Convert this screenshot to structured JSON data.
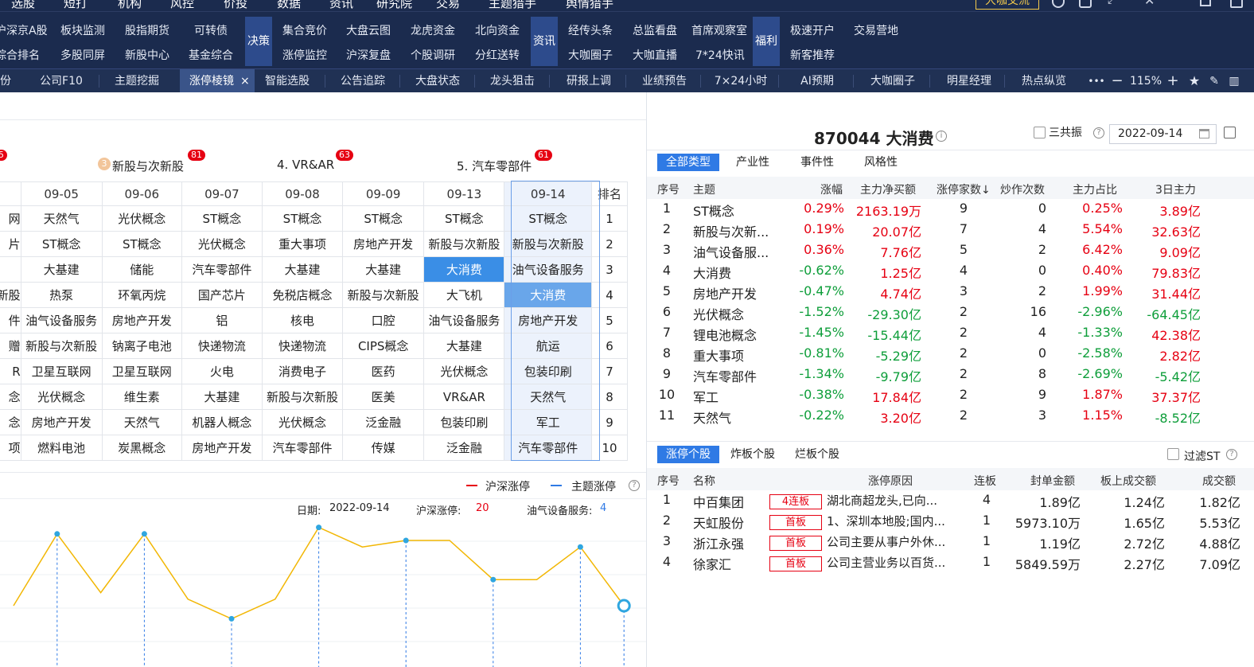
{
  "menubar": {
    "items": [
      "选股",
      "短打",
      "机构",
      "风控",
      "价投",
      "数据",
      "资讯",
      "研究院",
      "交易",
      "主题猎手",
      "舆情猎手"
    ],
    "special": "大咖交流"
  },
  "quickbar": {
    "col1": [
      "沪深京A股",
      "综合排名"
    ],
    "col2": [
      "板块监测",
      "多股同屏"
    ],
    "col3": [
      "股指期货",
      "新股中心"
    ],
    "col4": [
      "可转债",
      "基金综合"
    ],
    "grp1": "决策",
    "col5": [
      "集合竞价",
      "涨停监控"
    ],
    "col6": [
      "大盘云图",
      "沪深复盘"
    ],
    "col7": [
      "龙虎资金",
      "个股调研"
    ],
    "col8": [
      "北向资金",
      "分红送转"
    ],
    "grp2": "资讯",
    "col9": [
      "经传头条",
      "大咖圈子"
    ],
    "col10": [
      "总监看盘",
      "大咖直播"
    ],
    "col11": [
      "首席观察室",
      "7*24快讯"
    ],
    "grp3": "福利",
    "col12": [
      "极速开户",
      "新客推荐"
    ],
    "col13": [
      "交易营地"
    ]
  },
  "tabbar": {
    "tabs": [
      "份",
      "公司F10",
      "主题挖掘",
      "涨停棱镜",
      "智能选股",
      "公告追踪",
      "大盘状态",
      "龙头狙击",
      "研报上调",
      "业绩预告",
      "7×24小时",
      "AI预期",
      "大咖圈子",
      "明星经理",
      "热点纵览"
    ],
    "active_close": "×",
    "more": "•••",
    "minus": "−",
    "zoom": "115%",
    "plus": "+"
  },
  "left": {
    "featured": [
      {
        "rank": "3",
        "name": "新股与次新股",
        "count": "81"
      },
      {
        "name": "4. VR&AR",
        "count": "63"
      },
      {
        "name": "5. 汽车零部件",
        "count": "61"
      }
    ],
    "first_badge": "5",
    "dates": [
      "09-05",
      "09-06",
      "09-07",
      "09-08",
      "09-09",
      "09-13",
      "09-14"
    ],
    "rank_header": "排名",
    "cut_col": [
      "网",
      "片",
      "",
      "新股",
      "件",
      "赠",
      "R",
      "念",
      "念",
      "项"
    ],
    "grid": [
      [
        "天然气",
        "光伏概念",
        "ST概念",
        "ST概念",
        "ST概念",
        "ST概念",
        "ST概念"
      ],
      [
        "ST概念",
        "ST概念",
        "光伏概念",
        "重大事项",
        "房地产开发",
        "新股与次新股",
        "新股与次新股"
      ],
      [
        "大基建",
        "储能",
        "汽车零部件",
        "大基建",
        "大基建",
        "大消费",
        "油气设备服务"
      ],
      [
        "热泵",
        "环氧丙烷",
        "国产芯片",
        "免税店概念",
        "新股与次新股",
        "大飞机",
        "大消费"
      ],
      [
        "油气设备服务",
        "房地产开发",
        "铝",
        "核电",
        "口腔",
        "油气设备服务",
        "房地产开发"
      ],
      [
        "新股与次新股",
        "钠离子电池",
        "快递物流",
        "快递物流",
        "CIPS概念",
        "大基建",
        "航运"
      ],
      [
        "卫星互联网",
        "卫星互联网",
        "火电",
        "消费电子",
        "医药",
        "光伏概念",
        "包装印刷"
      ],
      [
        "光伏概念",
        "维生素",
        "大基建",
        "新股与次新股",
        "医美",
        "VR&AR",
        "天然气"
      ],
      [
        "房地产开发",
        "天然气",
        "机器人概念",
        "光伏概念",
        "泛金融",
        "包装印刷",
        "军工"
      ],
      [
        "燃料电池",
        "炭黑概念",
        "房地产开发",
        "汽车零部件",
        "传媒",
        "泛金融",
        "汽车零部件"
      ]
    ],
    "ranks": [
      "1",
      "2",
      "3",
      "4",
      "5",
      "6",
      "7",
      "8",
      "9",
      "10"
    ],
    "legend": {
      "a": "沪深涨停",
      "b": "主题涨停"
    },
    "info": {
      "date_label": "日期:",
      "date": "2022-09-14",
      "hs_label": "沪深涨停:",
      "hs_val": "20",
      "theme_label": "油气设备服务:",
      "theme_val": "4"
    },
    "colors": {
      "line": "#f2b705",
      "legend_red": "#e60012",
      "legend_blue": "#2f7ae5"
    }
  },
  "chart_data": {
    "type": "line",
    "series": [
      {
        "name": "沪深涨停",
        "values": [
          20,
          31,
          22,
          31,
          21,
          18,
          21,
          32,
          29,
          30,
          30,
          24,
          24,
          29,
          20
        ]
      }
    ],
    "xlabel": "",
    "ylabel": "",
    "grid": true
  },
  "right": {
    "title": "870044 大消费",
    "checkbox_label": "三共振",
    "date": "2022-09-14",
    "filters": [
      "全部类型",
      "产业性",
      "事件性",
      "风格性"
    ],
    "headers": [
      "序号",
      "主题",
      "涨幅",
      "主力净买额",
      "涨停家数↓",
      "炒作次数",
      "主力占比",
      "3日主力"
    ],
    "rows": [
      {
        "idx": "1",
        "name": "ST概念",
        "chg": "0.29%",
        "net": "2163.19万",
        "zt": "9",
        "hype": "0",
        "ratio": "0.25%",
        "d3": "3.89亿"
      },
      {
        "idx": "2",
        "name": "新股与次新...",
        "chg": "0.19%",
        "net": "20.07亿",
        "zt": "7",
        "hype": "4",
        "ratio": "5.54%",
        "d3": "32.63亿"
      },
      {
        "idx": "3",
        "name": "油气设备服...",
        "chg": "0.36%",
        "net": "7.76亿",
        "zt": "5",
        "hype": "2",
        "ratio": "6.42%",
        "d3": "9.09亿"
      },
      {
        "idx": "4",
        "name": "大消费",
        "chg": "-0.62%",
        "net": "1.25亿",
        "zt": "4",
        "hype": "0",
        "ratio": "0.40%",
        "d3": "79.83亿"
      },
      {
        "idx": "5",
        "name": "房地产开发",
        "chg": "-0.47%",
        "net": "4.74亿",
        "zt": "3",
        "hype": "2",
        "ratio": "1.99%",
        "d3": "31.44亿"
      },
      {
        "idx": "6",
        "name": "光伏概念",
        "chg": "-1.52%",
        "net": "-29.30亿",
        "zt": "2",
        "hype": "16",
        "ratio": "-2.96%",
        "d3": "-64.45亿"
      },
      {
        "idx": "7",
        "name": "锂电池概念",
        "chg": "-1.45%",
        "net": "-15.44亿",
        "zt": "2",
        "hype": "4",
        "ratio": "-1.33%",
        "d3": "42.38亿"
      },
      {
        "idx": "8",
        "name": "重大事项",
        "chg": "-0.81%",
        "net": "-5.29亿",
        "zt": "2",
        "hype": "0",
        "ratio": "-2.58%",
        "d3": "2.82亿"
      },
      {
        "idx": "9",
        "name": "汽车零部件",
        "chg": "-1.34%",
        "net": "-9.79亿",
        "zt": "2",
        "hype": "8",
        "ratio": "-2.69%",
        "d3": "-5.42亿"
      },
      {
        "idx": "10",
        "name": "军工",
        "chg": "-0.38%",
        "net": "17.84亿",
        "zt": "2",
        "hype": "9",
        "ratio": "1.87%",
        "d3": "37.37亿"
      },
      {
        "idx": "11",
        "name": "天然气",
        "chg": "-0.22%",
        "net": "3.20亿",
        "zt": "2",
        "hype": "3",
        "ratio": "1.15%",
        "d3": "-8.52亿"
      }
    ],
    "stock_tabs": [
      "涨停个股",
      "炸板个股",
      "烂板个股"
    ],
    "filter_st": "过滤ST",
    "stock_headers": [
      "序号",
      "名称",
      "涨停原因",
      "连板",
      "封单金额",
      "板上成交额",
      "成交额"
    ],
    "stocks": [
      {
        "idx": "1",
        "name": "中百集团",
        "tag": "4连板",
        "reason": "湖北商超龙头,已向...",
        "lb": "4",
        "fd": "1.89亿",
        "bs": "1.24亿",
        "cj": "1.82亿"
      },
      {
        "idx": "2",
        "name": "天虹股份",
        "tag": "首板",
        "reason": "1、深圳本地股;国内...",
        "lb": "1",
        "fd": "5973.10万",
        "bs": "1.65亿",
        "cj": "5.53亿"
      },
      {
        "idx": "3",
        "name": "浙江永强",
        "tag": "首板",
        "reason": "公司主要从事户外休...",
        "lb": "1",
        "fd": "1.19亿",
        "bs": "2.72亿",
        "cj": "4.88亿"
      },
      {
        "idx": "4",
        "name": "徐家汇",
        "tag": "首板",
        "reason": "公司主营业务以百货...",
        "lb": "1",
        "fd": "5849.59万",
        "bs": "2.27亿",
        "cj": "7.09亿"
      }
    ]
  }
}
